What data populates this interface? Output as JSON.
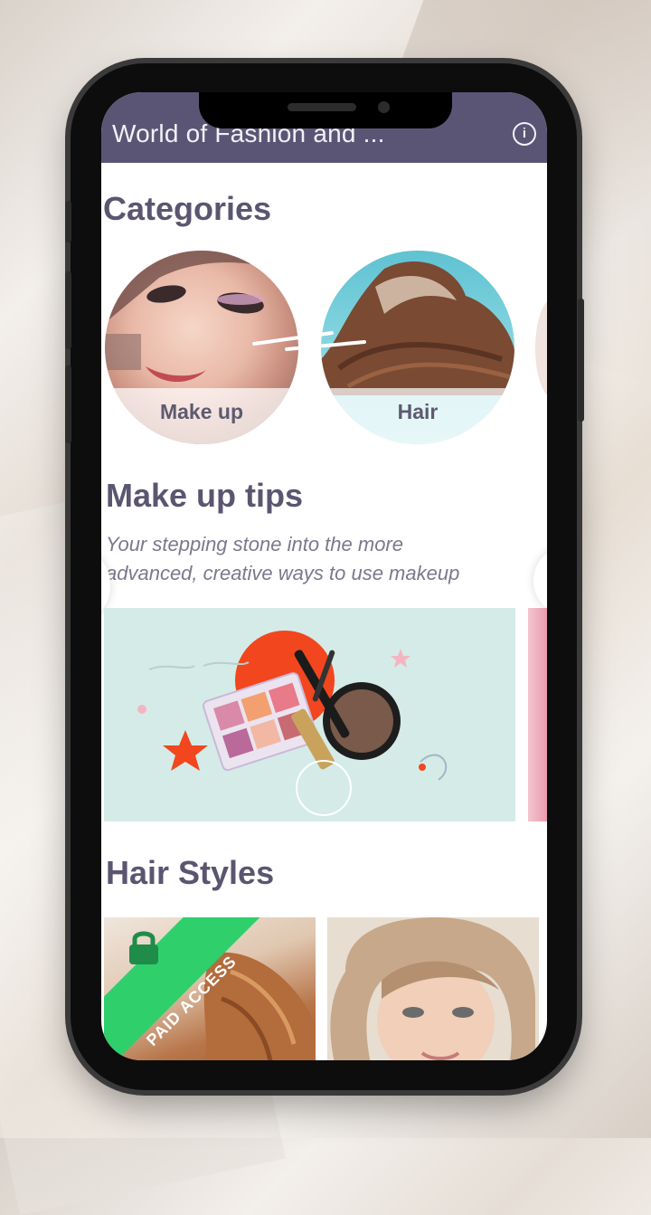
{
  "appbar": {
    "title": "World of Fashion and ...",
    "info_icon": "info-icon",
    "background": "#5b5575"
  },
  "categories": {
    "heading": "Categories",
    "items": [
      {
        "label": "Make up"
      },
      {
        "label": "Hair"
      }
    ]
  },
  "makeup_tips": {
    "heading": "Make up tips",
    "subtitle_line1": "Your stepping stone into the more",
    "subtitle_line2": "advanced, creative ways to use makeup"
  },
  "hair_styles": {
    "heading": "Hair Styles",
    "badge": "PAID ACCESS",
    "lock_icon": "lock-icon",
    "badge_color": "#2fcf6c"
  },
  "colors": {
    "heading": "#5b5570",
    "promo_bg": "#d5ebe7",
    "accent_red": "#f2461e"
  }
}
